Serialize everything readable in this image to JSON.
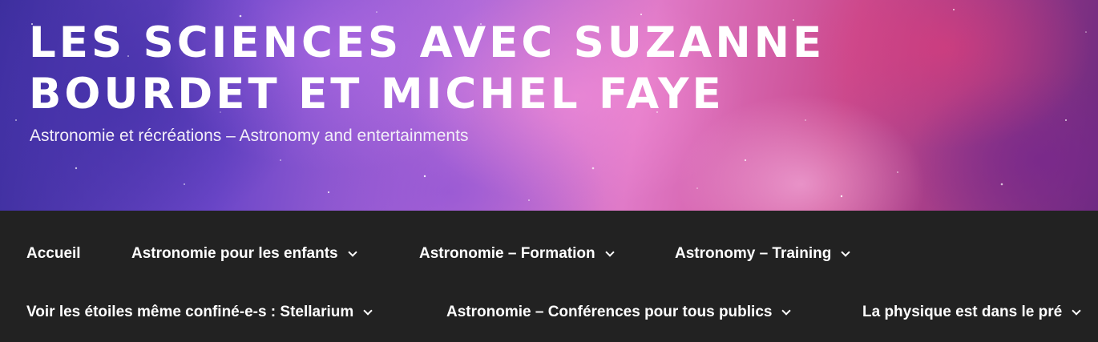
{
  "header": {
    "title": "LES SCIENCES AVEC SUZANNE BOURDET ET MICHEL FAYE",
    "description": "Astronomie et récréations – Astronomy and entertainments"
  },
  "nav": {
    "items": [
      {
        "label": "Accueil",
        "has_submenu": false
      },
      {
        "label": "Astronomie pour les enfants",
        "has_submenu": true,
        "icon": "chevron-down-icon"
      },
      {
        "label": "Astronomie – Formation",
        "has_submenu": true,
        "icon": "chevron-down-icon"
      },
      {
        "label": "Astronomy – Training",
        "has_submenu": true,
        "icon": "chevron-down-icon"
      },
      {
        "label": "Voir les étoiles même confiné-e-s : Stellarium",
        "has_submenu": true,
        "icon": "chevron-down-icon"
      },
      {
        "label": "Astronomie – Conférences pour tous publics",
        "has_submenu": true,
        "icon": "chevron-down-icon"
      },
      {
        "label": "La physique est dans le pré",
        "has_submenu": true,
        "icon": "chevron-down-icon"
      }
    ]
  },
  "colors": {
    "nav_background": "#222222",
    "nav_text": "#ffffff",
    "title_text": "#ffffff"
  }
}
